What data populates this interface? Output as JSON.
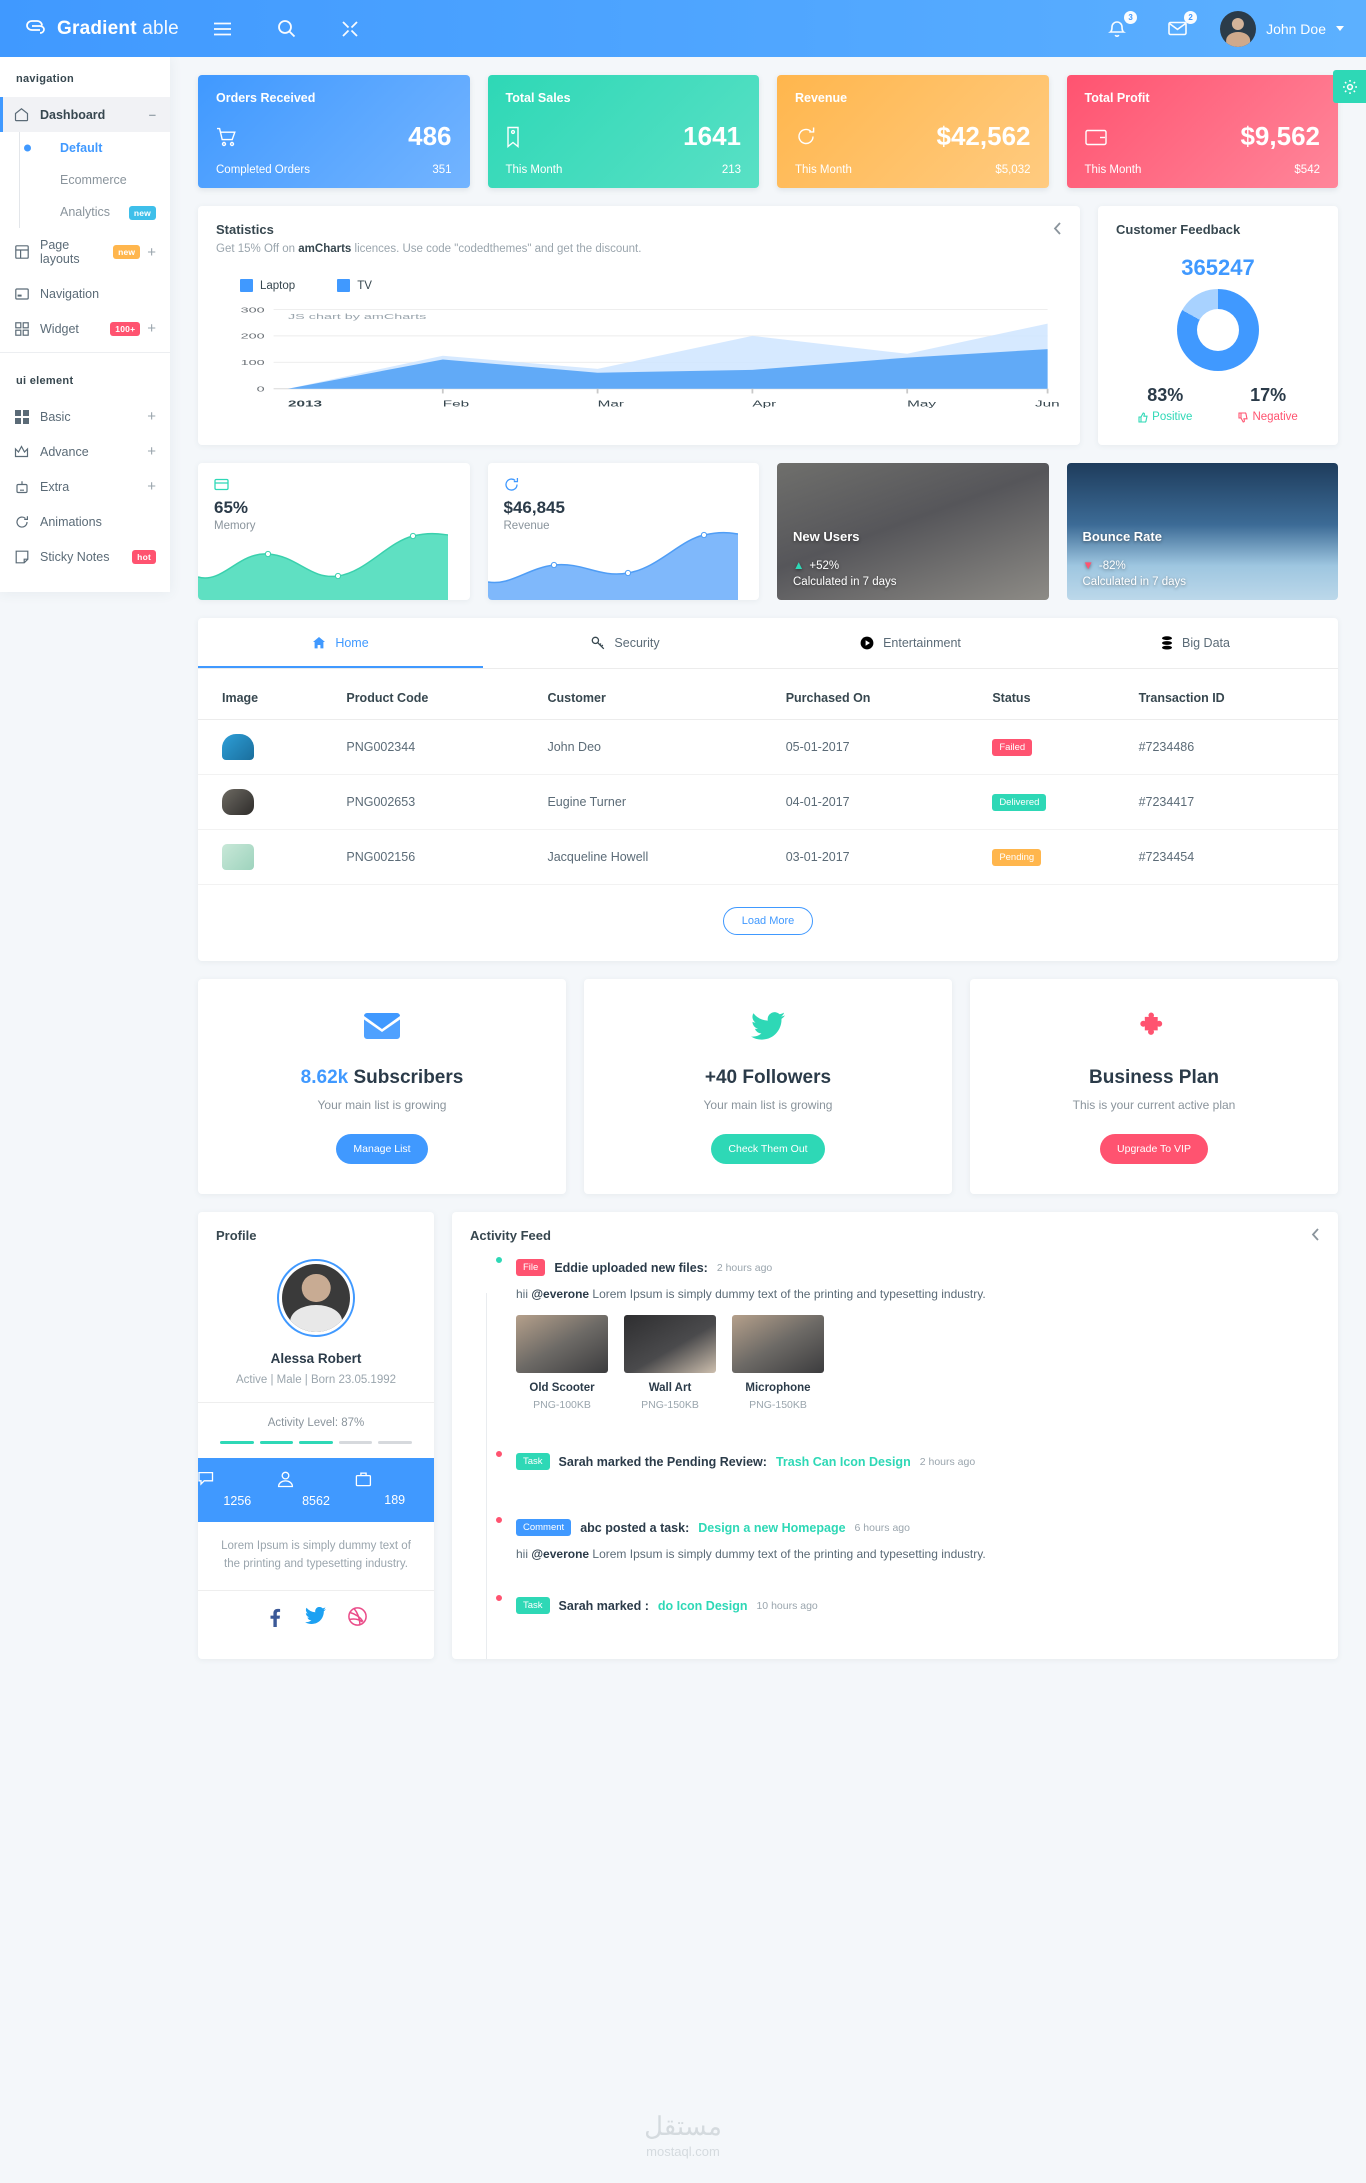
{
  "topbar": {
    "brand_bold": "Gradient",
    "brand_light": " able",
    "menu_icon": "hamburger-icon",
    "search_icon": "search-icon",
    "expand_icon": "fullscreen-icon",
    "bell_icon": "bell-icon",
    "bell_count": "3",
    "mail_icon": "mail-icon",
    "mail_count": "2",
    "user_name": "John Doe"
  },
  "sidebar": {
    "caption_nav": "navigation",
    "caption_ui": "ui element",
    "dashboard": {
      "label": "Dashboard",
      "icon": "home-icon",
      "collapse": "–"
    },
    "sub_items": [
      {
        "label": "Default",
        "badge": "",
        "current": true
      },
      {
        "label": "Ecommerce",
        "badge": ""
      },
      {
        "label": "Analytics",
        "badge": "new"
      }
    ],
    "items": [
      {
        "label": "Page layouts",
        "icon": "layout-icon",
        "badge": "new",
        "expand": "+"
      },
      {
        "label": "Navigation",
        "icon": "navbar-icon",
        "badge": "",
        "expand": ""
      },
      {
        "label": "Widget",
        "icon": "grid-icon",
        "badge": "100+",
        "expand": "+"
      }
    ],
    "ui_items": [
      {
        "label": "Basic",
        "icon": "squares-icon",
        "expand": "+"
      },
      {
        "label": "Advance",
        "icon": "crown-icon",
        "expand": "+"
      },
      {
        "label": "Extra",
        "icon": "robot-icon",
        "expand": "+"
      },
      {
        "label": "Animations",
        "icon": "refresh-icon",
        "expand": ""
      },
      {
        "label": "Sticky Notes",
        "icon": "note-icon",
        "badge": "hot",
        "expand": ""
      }
    ]
  },
  "stats": [
    {
      "title": "Orders Received",
      "value": "486",
      "foot_label": "Completed Orders",
      "foot_value": "351",
      "icon": "cart-icon",
      "color": "#4099ff"
    },
    {
      "title": "Total Sales",
      "value": "1641",
      "foot_label": "This Month",
      "foot_value": "213",
      "icon": "tag-icon",
      "color": "#2ed8b6"
    },
    {
      "title": "Revenue",
      "value": "$42,562",
      "foot_label": "This Month",
      "foot_value": "$5,032",
      "icon": "refresh-icon",
      "color": "#ffb64d"
    },
    {
      "title": "Total Profit",
      "value": "$9,562",
      "foot_label": "This Month",
      "foot_value": "$542",
      "icon": "wallet-icon",
      "color": "#ff5370"
    }
  ],
  "statistics": {
    "title": "Statistics",
    "subtitle_pre": "Get 15% Off on ",
    "subtitle_bold": "amCharts",
    "subtitle_post": " licences. Use code \"codedthemes\" and get the discount.",
    "collapse_icon": "chevron-left-icon",
    "credit": "JS chart by amCharts"
  },
  "chart_data": {
    "type": "area",
    "title": "Statistics",
    "categories": [
      "2013",
      "Feb",
      "Mar",
      "Apr",
      "May",
      "Jun"
    ],
    "series": [
      {
        "name": "Laptop",
        "color": "#4099ff",
        "values": [
          0,
          110,
          62,
          70,
          118,
          150
        ]
      },
      {
        "name": "TV",
        "color": "#4099ff",
        "values": [
          0,
          125,
          75,
          200,
          130,
          245
        ]
      }
    ],
    "yticks": [
      0,
      100,
      200,
      300
    ],
    "ylim": [
      0,
      300
    ],
    "xlabel": "",
    "ylabel": "",
    "grid": true,
    "legend": "top-left"
  },
  "feedback": {
    "title": "Customer Feedback",
    "total": "365247",
    "positive_pct": "83%",
    "positive_label": "Positive",
    "negative_pct": "17%",
    "negative_label": "Negative",
    "positive_icon": "thumbs-up-icon",
    "negative_icon": "thumbs-down-icon",
    "donut_positive": 83,
    "donut_negative": 17
  },
  "mini": [
    {
      "value": "65%",
      "label": "Memory",
      "icon": "memory-icon",
      "color": "#2ed8b6"
    },
    {
      "value": "$46,845",
      "label": "Revenue",
      "icon": "refresh-icon",
      "color": "#4099ff"
    }
  ],
  "photos": [
    {
      "title": "New Users",
      "pct": "+52%",
      "dir": "up",
      "sub": "Calculated in 7 days",
      "image": "office-photo"
    },
    {
      "title": "Bounce Rate",
      "pct": "-82%",
      "dir": "down",
      "sub": "Calculated in 7 days",
      "image": "cloud-photo"
    }
  ],
  "tabs": [
    {
      "label": "Home",
      "icon": "home-icon",
      "active": true
    },
    {
      "label": "Security",
      "icon": "key-icon",
      "active": false
    },
    {
      "label": "Entertainment",
      "icon": "play-icon",
      "active": false
    },
    {
      "label": "Big Data",
      "icon": "database-icon",
      "active": false
    }
  ],
  "table": {
    "columns": [
      "Image",
      "Product Code",
      "Customer",
      "Purchased On",
      "Status",
      "Transaction ID"
    ],
    "rows": [
      {
        "image": "cap-thumb",
        "code": "PNG002344",
        "customer": "John Deo",
        "date": "05-01-2017",
        "status": "Failed",
        "status_class": "p-failed",
        "txn": "#7234486"
      },
      {
        "image": "mouse-thumb",
        "code": "PNG002653",
        "customer": "Eugine Turner",
        "date": "04-01-2017",
        "status": "Delivered",
        "status_class": "p-delivered",
        "txn": "#7234417"
      },
      {
        "image": "bag-thumb",
        "code": "PNG002156",
        "customer": "Jacqueline Howell",
        "date": "03-01-2017",
        "status": "Pending",
        "status_class": "p-pending",
        "txn": "#7234454"
      }
    ],
    "load_more": "Load More"
  },
  "social_cards": [
    {
      "icon": "envelope-icon",
      "highlight": "8.62k",
      "heading": " Subscribers",
      "text": "Your main list is growing",
      "button": "Manage List",
      "btn_class": "bg-blue"
    },
    {
      "icon": "twitter-icon",
      "highlight": "",
      "heading": "+40 Followers",
      "text": "Your main list is growing",
      "button": "Check Them Out",
      "btn_class": "bg-green"
    },
    {
      "icon": "puzzle-icon",
      "highlight": "",
      "heading": "Business Plan",
      "text": "This is your current active plan",
      "button": "Upgrade To VIP",
      "btn_class": "bg-pink"
    }
  ],
  "profile": {
    "title": "Profile",
    "name": "Alessa Robert",
    "meta": "Active | Male | Born 23.05.1992",
    "activity": "Activity Level: 87%",
    "bars_on": 3,
    "bars_total": 5,
    "stats": [
      {
        "icon": "comment-icon",
        "value": "1256"
      },
      {
        "icon": "user-icon",
        "value": "8562"
      },
      {
        "icon": "briefcase-icon",
        "value": "189"
      }
    ],
    "text": "Lorem Ipsum is simply dummy text of the printing and typesetting industry.",
    "social": [
      "facebook-icon",
      "twitter-icon",
      "dribbble-icon"
    ]
  },
  "feed": {
    "title": "Activity Feed",
    "collapse_icon": "chevron-left-icon",
    "items": [
      {
        "tag": "File",
        "tag_class": "t-file",
        "title": "Eddie uploaded new files:",
        "time": "2 hours ago",
        "text_pre": "hii ",
        "text_bold": "@everone",
        "text_post": " Lorem Ipsum is simply dummy text of the printing and typesetting industry.",
        "dot": "d-green",
        "avatar": "av-1",
        "files": [
          {
            "name": "Old Scooter",
            "size": "PNG-100KB"
          },
          {
            "name": "Wall Art",
            "size": "PNG-150KB"
          },
          {
            "name": "Microphone",
            "size": "PNG-150KB"
          }
        ]
      },
      {
        "tag": "Task",
        "tag_class": "t-task",
        "title": "Sarah marked the Pending Review:",
        "link": "Trash Can Icon Design",
        "time": "2 hours ago",
        "dot": "d-pink",
        "avatar": "av-2"
      },
      {
        "tag": "Comment",
        "tag_class": "t-comment",
        "title": "abc posted a task:",
        "link": "Design a new Homepage",
        "time": "6 hours ago",
        "text_pre": "hii ",
        "text_bold": "@everone",
        "text_post": " Lorem Ipsum is simply dummy text of the printing and typesetting industry.",
        "dot": "d-pink",
        "avatar": "av-3"
      },
      {
        "tag": "Task",
        "tag_class": "t-task",
        "title": "Sarah marked :",
        "link": "do Icon Design",
        "time": "10 hours ago",
        "dot": "d-pink",
        "avatar": "av-4"
      }
    ]
  },
  "settings": {
    "icon": "gear-icon"
  },
  "watermark": {
    "arabic": "مستقل",
    "latin": "mostaql.com"
  }
}
